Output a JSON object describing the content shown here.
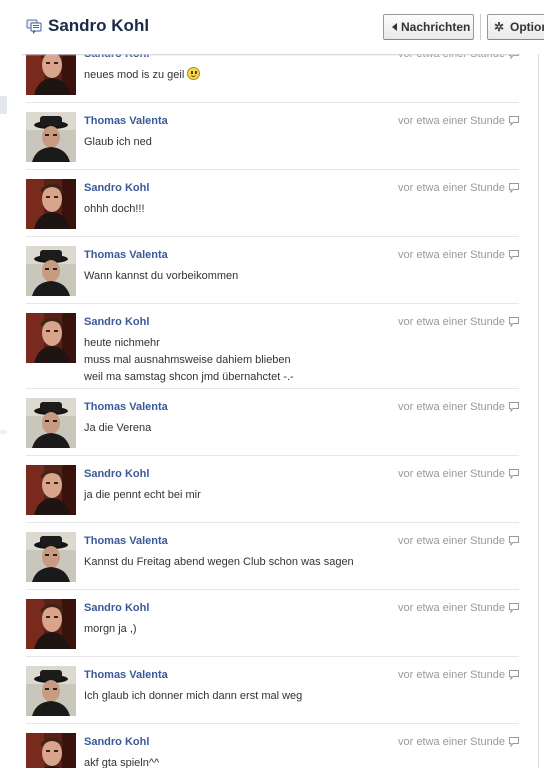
{
  "header": {
    "title": "Sandro Kohl",
    "back_label": "Nachrichten",
    "options_label": "Optionen"
  },
  "messages": [
    {
      "author": "Sandro Kohl",
      "time": "vor etwa einer Stunde",
      "lines": [
        "neues mod is zu geil"
      ],
      "emoji": "smiley",
      "avatar": "sandro"
    },
    {
      "author": "Thomas Valenta",
      "time": "vor etwa einer Stunde",
      "lines": [
        "Glaub ich ned"
      ],
      "avatar": "thomas"
    },
    {
      "author": "Sandro Kohl",
      "time": "vor etwa einer Stunde",
      "lines": [
        "ohhh doch!!!"
      ],
      "avatar": "sandro"
    },
    {
      "author": "Thomas Valenta",
      "time": "vor etwa einer Stunde",
      "lines": [
        "Wann kannst du vorbeikommen"
      ],
      "avatar": "thomas"
    },
    {
      "author": "Sandro Kohl",
      "time": "vor etwa einer Stunde",
      "lines": [
        "heute nichmehr",
        "muss mal ausnahmsweise dahiem blieben",
        "weil ma samstag shcon jmd übernahctet -.-"
      ],
      "avatar": "sandro"
    },
    {
      "author": "Thomas Valenta",
      "time": "vor etwa einer Stunde",
      "lines": [
        "Ja die Verena"
      ],
      "avatar": "thomas"
    },
    {
      "author": "Sandro Kohl",
      "time": "vor etwa einer Stunde",
      "lines": [
        "ja die pennt echt bei mir"
      ],
      "avatar": "sandro"
    },
    {
      "author": "Thomas Valenta",
      "time": "vor etwa einer Stunde",
      "lines": [
        "Kannst du Freitag abend wegen Club schon was sagen"
      ],
      "avatar": "thomas"
    },
    {
      "author": "Sandro Kohl",
      "time": "vor etwa einer Stunde",
      "lines": [
        "morgn ja ,)"
      ],
      "avatar": "sandro"
    },
    {
      "author": "Thomas Valenta",
      "time": "vor etwa einer Stunde",
      "lines": [
        "Ich glaub ich donner mich dann erst mal weg"
      ],
      "avatar": "thomas"
    },
    {
      "author": "Sandro Kohl",
      "time": "vor etwa einer Stunde",
      "lines": [
        "akf gta spieln^^"
      ],
      "avatar": "sandro"
    }
  ]
}
